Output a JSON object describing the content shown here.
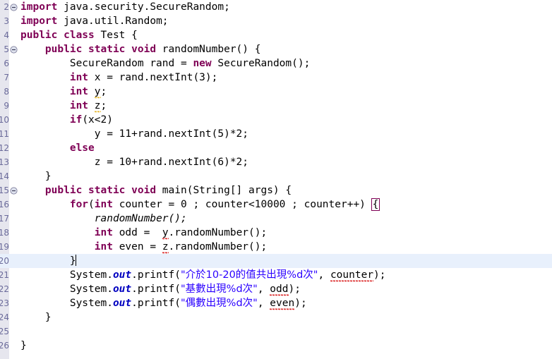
{
  "editor": {
    "name": "java-code-editor",
    "language": "Java",
    "class_name": "Test",
    "colors": {
      "background": "#ffffff",
      "gutter": "#e6e6ee",
      "current_line_highlight": "#e8f0fc",
      "keyword": "#7f0055",
      "string": "#2a00ff",
      "static_field": "#0000c0",
      "line_number": "#6a6a9a",
      "error_squiggle": "#d40000",
      "warning_squiggle": "#e0a800",
      "matching_bracket_border": "#7f0055"
    },
    "current_line": 19,
    "lines": [
      {
        "number": "2",
        "fold": "collapse",
        "indent": 0,
        "tokens": [
          {
            "t": "import",
            "c": "kw"
          },
          {
            "t": " java.security.SecureRandom;",
            "c": "id"
          }
        ]
      },
      {
        "number": "3",
        "fold": "",
        "indent": 0,
        "tokens": [
          {
            "t": "import",
            "c": "kw"
          },
          {
            "t": " java.util.Random;",
            "c": "id"
          }
        ]
      },
      {
        "number": "4",
        "fold": "",
        "indent": 0,
        "tokens": [
          {
            "t": "public class",
            "c": "kw"
          },
          {
            "t": " Test {",
            "c": "id"
          }
        ]
      },
      {
        "number": "5",
        "fold": "collapse",
        "indent": 1,
        "tokens": [
          {
            "t": "public static void",
            "c": "kw"
          },
          {
            "t": " randomNumber() {",
            "c": "id"
          }
        ]
      },
      {
        "number": "6",
        "fold": "",
        "indent": 2,
        "tokens": [
          {
            "t": "SecureRandom rand = ",
            "c": "id"
          },
          {
            "t": "new",
            "c": "kw"
          },
          {
            "t": " SecureRandom();",
            "c": "id"
          }
        ]
      },
      {
        "number": "7",
        "fold": "",
        "indent": 2,
        "tokens": [
          {
            "t": "int",
            "c": "kw"
          },
          {
            "t": " x = rand.nextInt(3);",
            "c": "id"
          }
        ]
      },
      {
        "number": "8",
        "fold": "",
        "indent": 2,
        "tokens": [
          {
            "t": "int",
            "c": "kw"
          },
          {
            "t": " ",
            "c": "id"
          },
          {
            "t": "y",
            "c": "id",
            "mark": "warn"
          },
          {
            "t": ";",
            "c": "id"
          }
        ]
      },
      {
        "number": "9",
        "fold": "",
        "indent": 2,
        "tokens": [
          {
            "t": "int",
            "c": "kw"
          },
          {
            "t": " ",
            "c": "id"
          },
          {
            "t": "z",
            "c": "id",
            "mark": "warn"
          },
          {
            "t": ";",
            "c": "id"
          }
        ]
      },
      {
        "number": "10",
        "fold": "",
        "indent": 2,
        "tokens": [
          {
            "t": "if",
            "c": "kw"
          },
          {
            "t": "(x<2)",
            "c": "id"
          }
        ]
      },
      {
        "number": "11",
        "fold": "",
        "indent": 3,
        "tokens": [
          {
            "t": "y = 11+rand.nextInt(5)*2;",
            "c": "id"
          }
        ]
      },
      {
        "number": "12",
        "fold": "",
        "indent": 2,
        "tokens": [
          {
            "t": "else",
            "c": "kw"
          }
        ]
      },
      {
        "number": "13",
        "fold": "",
        "indent": 3,
        "tokens": [
          {
            "t": "z = 10+rand.nextInt(6)*2;",
            "c": "id"
          }
        ]
      },
      {
        "number": "14",
        "fold": "",
        "indent": 1,
        "tokens": [
          {
            "t": "}",
            "c": "id"
          }
        ]
      },
      {
        "number": "15",
        "fold": "collapse",
        "indent": 1,
        "tokens": [
          {
            "t": "public static void",
            "c": "kw"
          },
          {
            "t": " main(String[] args) {",
            "c": "id"
          }
        ]
      },
      {
        "number": "16",
        "fold": "",
        "indent": 2,
        "tokens": [
          {
            "t": "for",
            "c": "kw"
          },
          {
            "t": "(",
            "c": "id"
          },
          {
            "t": "int",
            "c": "kw"
          },
          {
            "t": " counter = 0 ; counter<10000 ; counter++) ",
            "c": "id"
          },
          {
            "t": "{",
            "c": "id",
            "mark": "brace"
          }
        ]
      },
      {
        "number": "17",
        "fold": "",
        "indent": 3,
        "tokens": [
          {
            "t": "randomNumber();",
            "c": "mcall"
          }
        ]
      },
      {
        "number": "18",
        "fold": "",
        "indent": 3,
        "tokens": [
          {
            "t": "int",
            "c": "kw"
          },
          {
            "t": " odd =  ",
            "c": "id"
          },
          {
            "t": "y",
            "c": "id",
            "mark": "err"
          },
          {
            "t": ".randomNumber();",
            "c": "id"
          }
        ]
      },
      {
        "number": "19",
        "fold": "",
        "indent": 3,
        "tokens": [
          {
            "t": "int",
            "c": "kw"
          },
          {
            "t": " even = ",
            "c": "id"
          },
          {
            "t": "z",
            "c": "id",
            "mark": "err"
          },
          {
            "t": ".randomNumber();",
            "c": "id"
          }
        ]
      },
      {
        "number": "20",
        "fold": "",
        "indent": 2,
        "current": true,
        "caret": true,
        "tokens": [
          {
            "t": "}",
            "c": "id"
          }
        ]
      },
      {
        "number": "21",
        "fold": "",
        "indent": 2,
        "tokens": [
          {
            "t": "System.",
            "c": "id"
          },
          {
            "t": "out",
            "c": "fld"
          },
          {
            "t": ".printf(",
            "c": "id"
          },
          {
            "t": "\"介於10-20的值共出現%d次\"",
            "c": "str",
            "cjk": true
          },
          {
            "t": ", ",
            "c": "id"
          },
          {
            "t": "counter",
            "c": "id",
            "mark": "err"
          },
          {
            "t": ");",
            "c": "id"
          }
        ]
      },
      {
        "number": "22",
        "fold": "",
        "indent": 2,
        "tokens": [
          {
            "t": "System.",
            "c": "id"
          },
          {
            "t": "out",
            "c": "fld"
          },
          {
            "t": ".printf(",
            "c": "id"
          },
          {
            "t": "\"基數出現%d次\"",
            "c": "str",
            "cjk": true
          },
          {
            "t": ", ",
            "c": "id"
          },
          {
            "t": "odd",
            "c": "id",
            "mark": "err"
          },
          {
            "t": ");",
            "c": "id"
          }
        ]
      },
      {
        "number": "23",
        "fold": "",
        "indent": 2,
        "tokens": [
          {
            "t": "System.",
            "c": "id"
          },
          {
            "t": "out",
            "c": "fld"
          },
          {
            "t": ".printf(",
            "c": "id"
          },
          {
            "t": "\"偶數出現%d次\"",
            "c": "str",
            "cjk": true
          },
          {
            "t": ", ",
            "c": "id"
          },
          {
            "t": "even",
            "c": "id",
            "mark": "err"
          },
          {
            "t": ");",
            "c": "id"
          }
        ]
      },
      {
        "number": "24",
        "fold": "",
        "indent": 1,
        "tokens": [
          {
            "t": "}",
            "c": "id"
          }
        ]
      },
      {
        "number": "25",
        "fold": "",
        "indent": 0,
        "tokens": []
      },
      {
        "number": "26",
        "fold": "",
        "indent": 0,
        "tokens": [
          {
            "t": "}",
            "c": "id"
          }
        ]
      }
    ]
  }
}
